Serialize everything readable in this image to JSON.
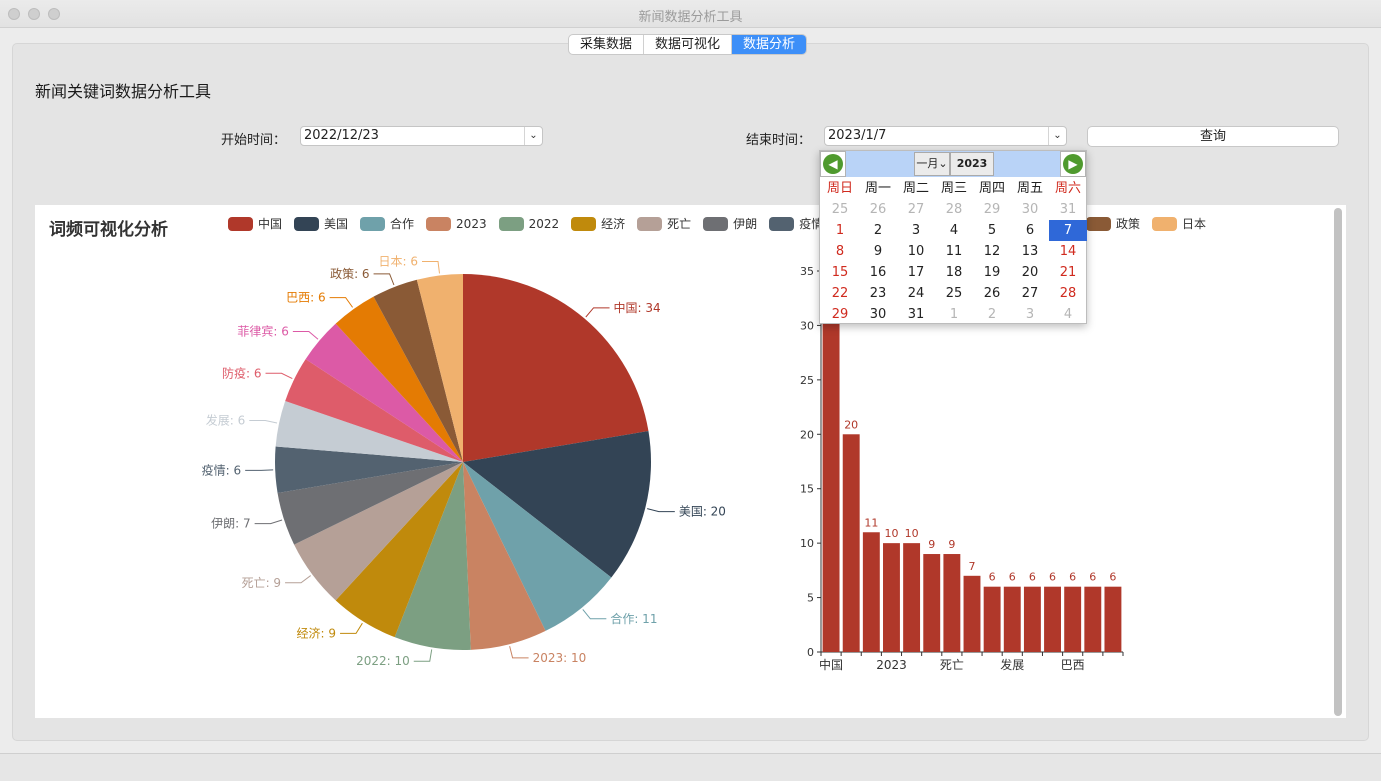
{
  "window": {
    "title": "新闻数据分析工具"
  },
  "tabs": [
    {
      "label": "采集数据",
      "active": false
    },
    {
      "label": "数据可视化",
      "active": false
    },
    {
      "label": "数据分析",
      "active": true
    }
  ],
  "page": {
    "heading": "新闻关键词数据分析工具"
  },
  "form": {
    "start_label": "开始时间：",
    "start_value": "2022/12/23",
    "end_label": "结束时间：",
    "end_value": "2023/1/7",
    "query_button": "查询"
  },
  "calendar": {
    "month_label": "一月",
    "year_label": "2023",
    "weekday_headers": [
      "周日",
      "周一",
      "周二",
      "周三",
      "周四",
      "周五",
      "周六"
    ],
    "weeks": [
      [
        {
          "d": "25",
          "dim": true
        },
        {
          "d": "26",
          "dim": true
        },
        {
          "d": "27",
          "dim": true
        },
        {
          "d": "28",
          "dim": true
        },
        {
          "d": "29",
          "dim": true
        },
        {
          "d": "30",
          "dim": true
        },
        {
          "d": "31",
          "dim": true
        }
      ],
      [
        {
          "d": "1"
        },
        {
          "d": "2"
        },
        {
          "d": "3"
        },
        {
          "d": "4"
        },
        {
          "d": "5"
        },
        {
          "d": "6"
        },
        {
          "d": "7",
          "selected": true
        }
      ],
      [
        {
          "d": "8"
        },
        {
          "d": "9"
        },
        {
          "d": "10"
        },
        {
          "d": "11"
        },
        {
          "d": "12"
        },
        {
          "d": "13"
        },
        {
          "d": "14"
        }
      ],
      [
        {
          "d": "15"
        },
        {
          "d": "16"
        },
        {
          "d": "17"
        },
        {
          "d": "18"
        },
        {
          "d": "19"
        },
        {
          "d": "20"
        },
        {
          "d": "21"
        }
      ],
      [
        {
          "d": "22"
        },
        {
          "d": "23"
        },
        {
          "d": "24"
        },
        {
          "d": "25"
        },
        {
          "d": "26"
        },
        {
          "d": "27"
        },
        {
          "d": "28"
        }
      ],
      [
        {
          "d": "29"
        },
        {
          "d": "30"
        },
        {
          "d": "31"
        },
        {
          "d": "1",
          "dim": true
        },
        {
          "d": "2",
          "dim": true
        },
        {
          "d": "3",
          "dim": true
        },
        {
          "d": "4",
          "dim": true
        }
      ]
    ],
    "weekend_color": "#d02a1e",
    "selected_color": "#2f68d8"
  },
  "chart_section": {
    "title": "词频可视化分析"
  },
  "legend_visible_left": [
    "中国",
    "美国",
    "合作",
    "2023",
    "2022",
    "经济",
    "死亡",
    "伊朗",
    "疫情"
  ],
  "legend_visible_right": [
    "政策",
    "日本"
  ],
  "chart_data": [
    {
      "type": "pie",
      "labels": [
        "中国",
        "美国",
        "合作",
        "2023",
        "2022",
        "经济",
        "死亡",
        "伊朗",
        "疫情",
        "发展",
        "防疫",
        "菲律宾",
        "巴西",
        "政策",
        "日本"
      ],
      "values": [
        34,
        20,
        11,
        10,
        10,
        9,
        9,
        7,
        6,
        6,
        6,
        6,
        6,
        6,
        6
      ],
      "colors": [
        "#b0382a",
        "#334455",
        "#6fa1aa",
        "#c98362",
        "#7c9f82",
        "#c08a0c",
        "#b5a097",
        "#6e6f73",
        "#536270",
        "#c5ccd3",
        "#de5c6a",
        "#dc5aa6",
        "#e47b03",
        "#8a5a36",
        "#f0b16e"
      ],
      "label_sep": ": "
    },
    {
      "type": "bar",
      "categories": [
        "中国",
        "美国",
        "合作",
        "2023",
        "2022",
        "经济",
        "死亡",
        "伊朗",
        "疫情",
        "发展",
        "防疫",
        "菲律宾",
        "巴西",
        "政策",
        "日本"
      ],
      "values": [
        34,
        20,
        11,
        10,
        10,
        9,
        9,
        7,
        6,
        6,
        6,
        6,
        6,
        6,
        6
      ],
      "shown_tick_labels": [
        "中国",
        "2023",
        "死亡",
        "发展",
        "巴西"
      ],
      "y_ticks": [
        0,
        5,
        10,
        15,
        20,
        25,
        30,
        35
      ],
      "ylim": [
        0,
        35
      ],
      "bar_color": "#b0382a"
    }
  ]
}
